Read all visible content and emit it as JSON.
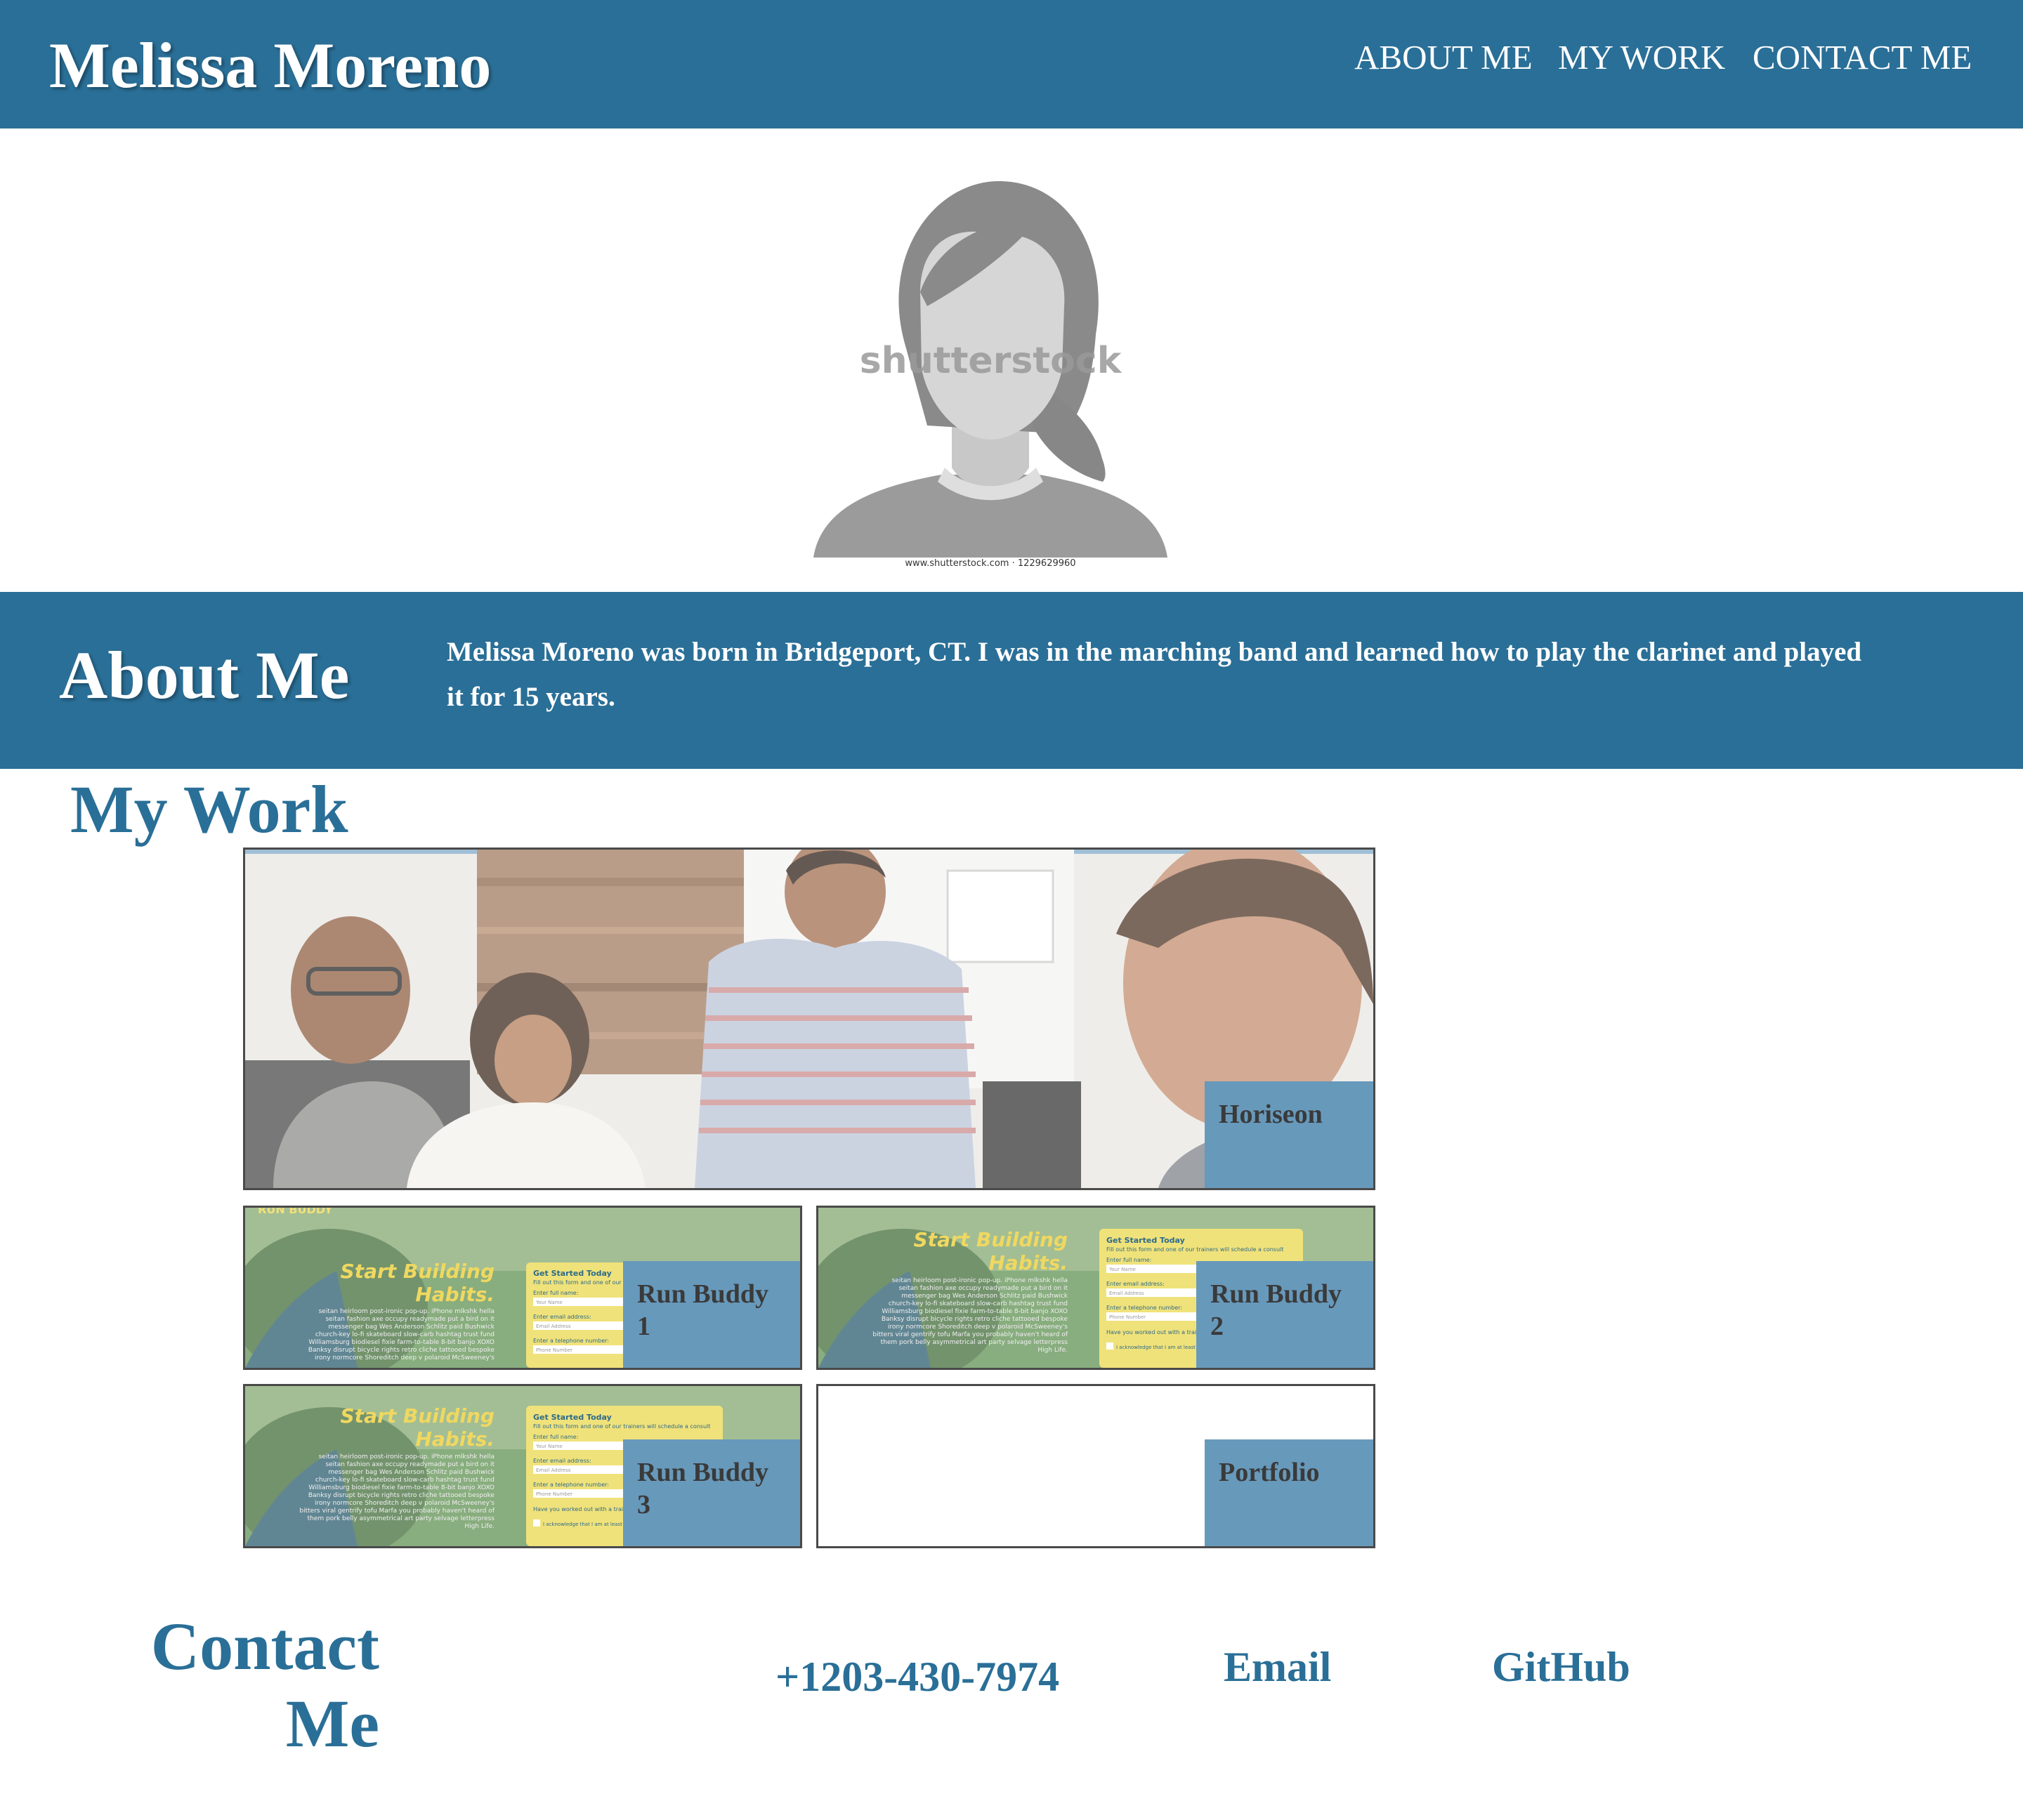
{
  "header": {
    "title": "Melissa Moreno",
    "nav": [
      "ABOUT ME",
      "MY WORK",
      "CONTACT ME"
    ]
  },
  "avatar": {
    "watermark": "shutterstock",
    "credit": "www.shutterstock.com · 1229629960"
  },
  "about": {
    "heading": "About Me",
    "text": "Melissa Moreno was born in Bridgeport, CT. I was in the marching band and learned how to play the clarinet and played it for 15 years."
  },
  "work": {
    "heading": "My Work",
    "projects": [
      {
        "label": "Horiseon"
      },
      {
        "label": "Run Buddy 1"
      },
      {
        "label": "Run Buddy 2"
      },
      {
        "label": "Run Buddy 3"
      },
      {
        "label": "Portfolio"
      }
    ],
    "preview": {
      "brand": "RUN BUDDY",
      "headline_1": "Start Building",
      "headline_2": "Habits.",
      "form_title": "Get Started Today",
      "form_sub": "Fill out this form and one of our trainers will schedule a consult",
      "field_1_label": "Enter full name:",
      "field_1_placeholder": "Your Name",
      "field_2_label": "Enter email address:",
      "field_2_placeholder": "Email Address",
      "field_3_label": "Enter a telephone number:",
      "field_3_placeholder": "Phone Number",
      "question": "Have you worked out with a trainer before?",
      "checkbox_text": "I acknowledge that I am at least 18 years of age.",
      "body_lines": [
        "seitan heirloom post-ironic pop-up. iPhone mlkshk hella",
        "seitan fashion axe occupy readymade put a bird on it",
        "messenger bag Wes Anderson Schlitz paid Bushwick",
        "church-key lo-fi skateboard slow-carb hashtag trust fund",
        "Williamsburg biodiesel fixie farm-to-table 8-bit banjo XOXO",
        "Banksy disrupt bicycle rights retro cliche tattooed bespoke",
        "irony normcore Shoreditch deep v polaroid McSweeney's",
        "bitters viral gentrify tofu Marfa you probably haven't heard of",
        "them pork belly asymmetrical art party selvage letterpress",
        "High Life."
      ]
    }
  },
  "contact": {
    "heading": "Contact Me",
    "phone": "+1203-430-7974",
    "email": "Email",
    "github": "GitHub"
  },
  "colors": {
    "primary": "#2a6f97",
    "card_label_bg": "#6799bb",
    "background": "#ffffff"
  }
}
